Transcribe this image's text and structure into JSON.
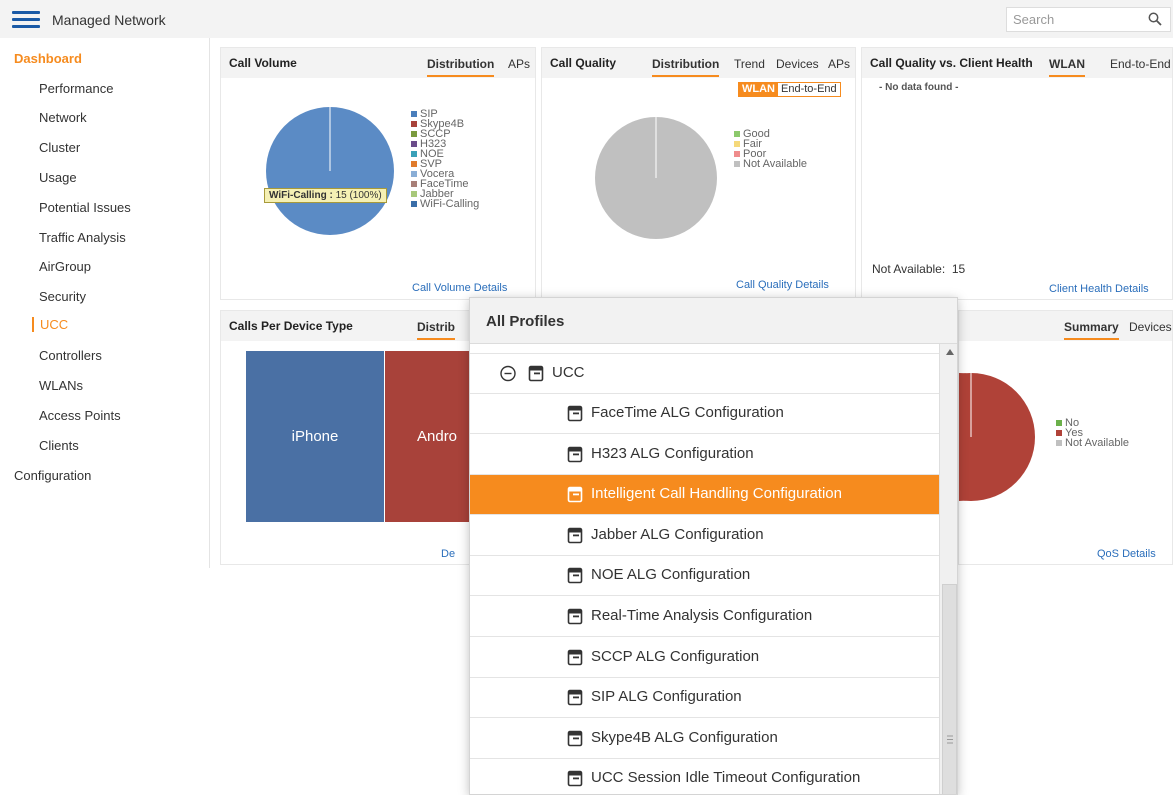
{
  "app": {
    "title": "Managed Network"
  },
  "search": {
    "placeholder": "Search"
  },
  "sidebar": {
    "items": [
      {
        "label": "Dashboard"
      },
      {
        "label": "Performance"
      },
      {
        "label": "Network"
      },
      {
        "label": "Cluster"
      },
      {
        "label": "Usage"
      },
      {
        "label": "Potential Issues"
      },
      {
        "label": "Traffic Analysis"
      },
      {
        "label": "AirGroup"
      },
      {
        "label": "Security"
      },
      {
        "label": "UCC"
      },
      {
        "label": "Controllers"
      },
      {
        "label": "WLANs"
      },
      {
        "label": "Access Points"
      },
      {
        "label": "Clients"
      },
      {
        "label": "Configuration"
      }
    ]
  },
  "widgets": {
    "call_volume": {
      "title": "Call Volume",
      "tabs": [
        "Distribution",
        "APs"
      ],
      "legend": [
        "SIP",
        "Skype4B",
        "SCCP",
        "H323",
        "NOE",
        "SVP",
        "Vocera",
        "FaceTime",
        "Jabber",
        "WiFi-Calling"
      ],
      "tooltip_label": "WiFi-Calling :",
      "tooltip_value": "15 (100%)",
      "link": "Call Volume Details"
    },
    "call_quality": {
      "title": "Call Quality",
      "tabs": [
        "Distribution",
        "Trend",
        "Devices",
        "APs"
      ],
      "toggle": [
        "WLAN",
        "End-to-End"
      ],
      "legend": [
        "Good",
        "Fair",
        "Poor",
        "Not Available"
      ],
      "link": "Call Quality Details"
    },
    "client_health": {
      "title": "Call Quality vs. Client Health",
      "tabs": [
        "WLAN",
        "End-to-End"
      ],
      "nodata": "- No data found -",
      "not_available": "Not Available:  15",
      "link": "Client Health Details"
    },
    "device_type": {
      "title": "Calls Per Device Type",
      "tab": "Distrib",
      "blocks": [
        "iPhone",
        "Andro"
      ],
      "link": "De"
    },
    "qos": {
      "tabs": [
        "Summary",
        "Devices"
      ],
      "legend": [
        "No",
        "Yes",
        "Not Available"
      ],
      "link": "QoS Details"
    }
  },
  "dropdown": {
    "title": "All Profiles",
    "group": "UCC",
    "items": [
      "FaceTime ALG Configuration",
      "H323 ALG Configuration",
      "Intelligent Call Handling Configuration",
      "Jabber ALG Configuration",
      "NOE ALG Configuration",
      "Real-Time Analysis Configuration",
      "SCCP ALG Configuration",
      "SIP ALG Configuration",
      "Skype4B ALG Configuration",
      "UCC Session Idle Timeout Configuration"
    ],
    "selected_index": 2
  },
  "colors": {
    "accent": "#f68b1e",
    "link": "#2a6ebb",
    "pie_blue": "#5b8bc5",
    "pie_gray": "#c0c0c0",
    "pie_red": "#b04238",
    "legend_swatches": [
      "#4a7ebb",
      "#a8423a",
      "#7a9a3e",
      "#6b4c8a",
      "#3aa0b8",
      "#e07b2c",
      "#8aaed6",
      "#a87f77",
      "#a8c87a",
      "#3a6ea8"
    ],
    "quality_swatches": [
      "#8cc96c",
      "#f5d97a",
      "#ef8c8c",
      "#c0c0c0"
    ],
    "qos_swatches": [
      "#6bb04a",
      "#b04238",
      "#c0c0c0"
    ]
  },
  "chart_data": [
    {
      "type": "pie",
      "categories": [
        "WiFi-Calling"
      ],
      "values": [
        15
      ]
    },
    {
      "type": "pie",
      "categories": [
        "Not Available"
      ],
      "values": [
        15
      ]
    }
  ]
}
